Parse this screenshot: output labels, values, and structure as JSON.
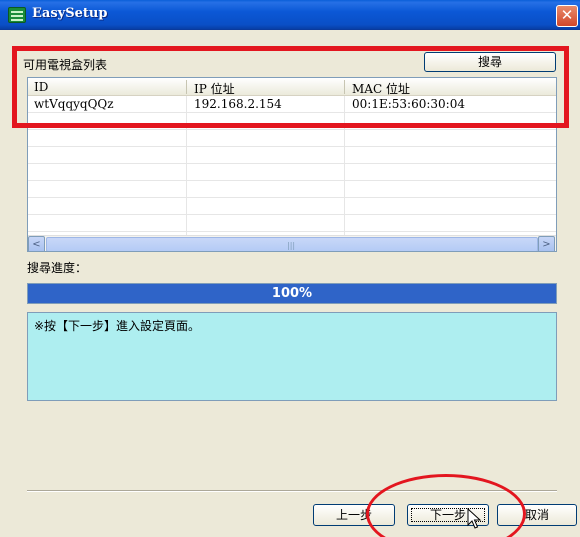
{
  "window": {
    "title": "EasySetup",
    "close_glyph": "✕"
  },
  "device_list": {
    "title": "可用電視盒列表",
    "search_label": "搜尋",
    "columns": [
      "ID",
      "IP 位址",
      "MAC 位址"
    ],
    "rows": [
      {
        "id": "wtVqqyqQQz",
        "ip": "192.168.2.154",
        "mac": "00:1E:53:60:30:04"
      }
    ],
    "scroll_left": "<",
    "scroll_right": ">",
    "scroll_grip": "|||"
  },
  "progress": {
    "label": "搜尋進度：",
    "value": 100,
    "text": "100%"
  },
  "message": "※按【下一步】進入設定頁面。",
  "buttons": {
    "prev": "上一步",
    "next": "下一步",
    "cancel": "取消"
  },
  "icons": {
    "app": "easysetup-app-icon",
    "cursor": "mouse-pointer-icon"
  },
  "colors": {
    "highlight": "#e3161f",
    "progress_fill": "#2f64c8",
    "message_bg": "#aeeef0"
  }
}
